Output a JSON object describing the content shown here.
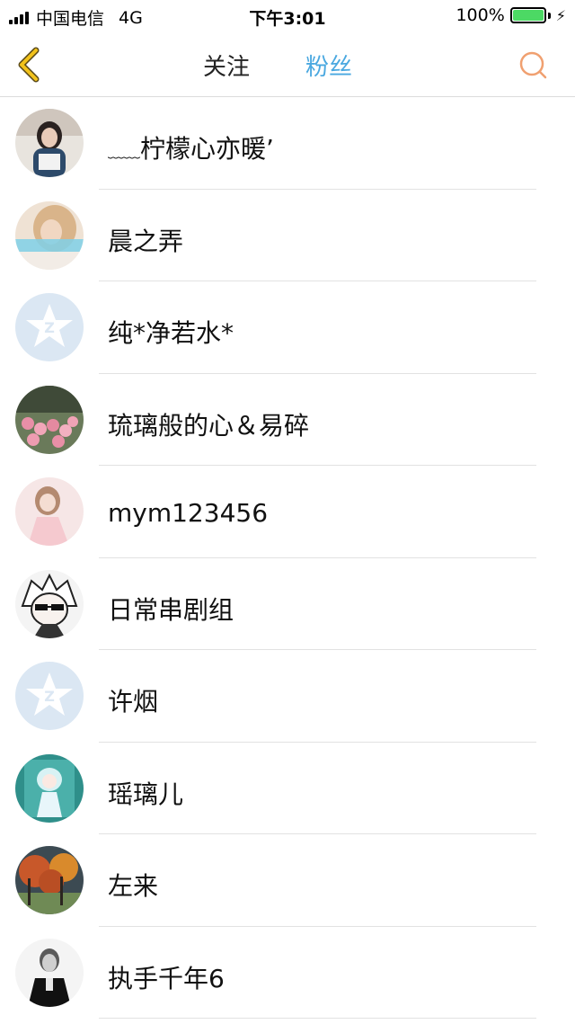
{
  "status_bar": {
    "carrier": "中国电信",
    "network": "4G",
    "time": "下午3:01",
    "battery": "100%",
    "battery_level": 1.0
  },
  "nav": {
    "back_icon": "chevron-left-icon",
    "tabs": [
      {
        "label": "关注",
        "active": false
      },
      {
        "label": "粉丝",
        "active": true
      }
    ],
    "search_icon": "search-icon",
    "colors": {
      "active_tab": "#4aa8e0",
      "back_icon": "#f2c21b",
      "search_icon": "#f0a070"
    }
  },
  "fans": [
    {
      "name": "柠檬心亦暖’",
      "prefix": "﹏﹏",
      "avatar": "photo-girl"
    },
    {
      "name": "晨之弄",
      "avatar": "photo-blonde"
    },
    {
      "name": "纯*净若水*",
      "avatar": "default-qq"
    },
    {
      "name": "琉璃般的心＆易碎",
      "avatar": "photo-flowers"
    },
    {
      "name": "mym123456",
      "avatar": "photo-pink-girl"
    },
    {
      "name": "日常串剧组",
      "avatar": "anime-sunglasses"
    },
    {
      "name": "许烟",
      "avatar": "default-qq"
    },
    {
      "name": "瑶璃儿",
      "avatar": "anime-teal"
    },
    {
      "name": "左来",
      "avatar": "photo-autumn-trees"
    },
    {
      "name": "执手千年6",
      "avatar": "photo-man-bw"
    }
  ]
}
